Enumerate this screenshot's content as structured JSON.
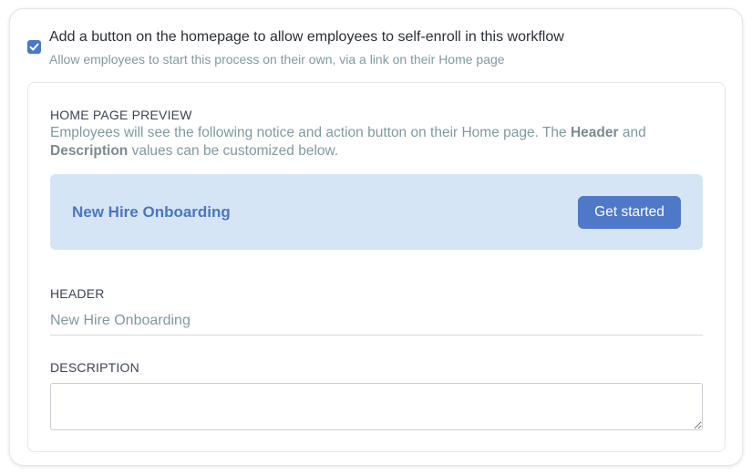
{
  "option": {
    "checked": true,
    "title": "Add a button on the homepage to allow employees to self-enroll in this workflow",
    "subtitle": "Allow employees to start this process on their own, via a link on their Home page"
  },
  "preview": {
    "heading": "HOME PAGE PREVIEW",
    "desc_part1": "Employees will see the following notice and action button on their Home page. The ",
    "desc_bold1": "Header",
    "desc_part2": " and ",
    "desc_bold2": "Description",
    "desc_part3": " values can be customized below.",
    "banner_title": "New Hire Onboarding",
    "button_label": "Get started"
  },
  "form": {
    "header_label": "HEADER",
    "header_value": "New Hire Onboarding",
    "description_label": "DESCRIPTION",
    "description_value": ""
  },
  "colors": {
    "accent": "#4f78c8",
    "banner_bg": "#d6e5f5",
    "banner_text": "#4a76c1",
    "muted_text": "#7f9a9f"
  }
}
